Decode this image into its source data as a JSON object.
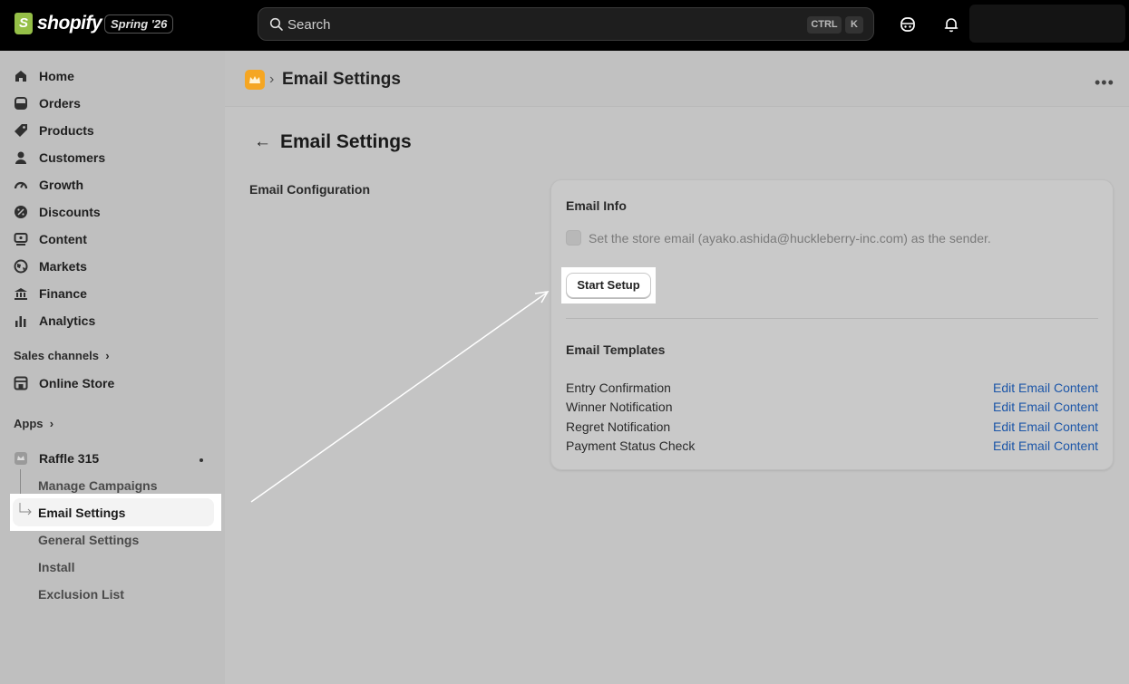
{
  "topbar": {
    "brand": "shopify",
    "edition": "Spring '26",
    "search_placeholder": "Search",
    "shortcut_ctrl": "CTRL",
    "shortcut_k": "K"
  },
  "sidebar": {
    "items": [
      {
        "label": "Home",
        "icon": "home-icon"
      },
      {
        "label": "Orders",
        "icon": "orders-icon"
      },
      {
        "label": "Products",
        "icon": "tag-icon"
      },
      {
        "label": "Customers",
        "icon": "person-icon"
      },
      {
        "label": "Growth",
        "icon": "gauge-icon"
      },
      {
        "label": "Discounts",
        "icon": "discount-icon"
      },
      {
        "label": "Content",
        "icon": "content-icon"
      },
      {
        "label": "Markets",
        "icon": "globe-icon"
      },
      {
        "label": "Finance",
        "icon": "bank-icon"
      },
      {
        "label": "Analytics",
        "icon": "bar-chart-icon"
      }
    ],
    "sales_channels_label": "Sales channels",
    "online_store_label": "Online Store",
    "apps_label": "Apps",
    "app_name": "Raffle 315",
    "app_sub_items": [
      "Manage Campaigns",
      "Email Settings",
      "General Settings",
      "Install",
      "Exclusion List"
    ]
  },
  "app_bar": {
    "title": "Email Settings"
  },
  "page": {
    "title": "Email Settings",
    "section_label": "Email Configuration",
    "email_info_heading": "Email Info",
    "sender_checkbox_label": "Set the store email (ayako.ashida@huckleberry-inc.com) as the sender.",
    "start_setup_label": "Start Setup",
    "templates_heading": "Email Templates",
    "templates": [
      {
        "name": "Entry Confirmation",
        "action": "Edit Email Content"
      },
      {
        "name": "Winner Notification",
        "action": "Edit Email Content"
      },
      {
        "name": "Regret Notification",
        "action": "Edit Email Content"
      },
      {
        "name": "Payment Status Check",
        "action": "Edit Email Content"
      }
    ]
  },
  "colors": {
    "link": "#1c56a8",
    "topbar": "#000000",
    "app_badge": "#f5a623"
  }
}
